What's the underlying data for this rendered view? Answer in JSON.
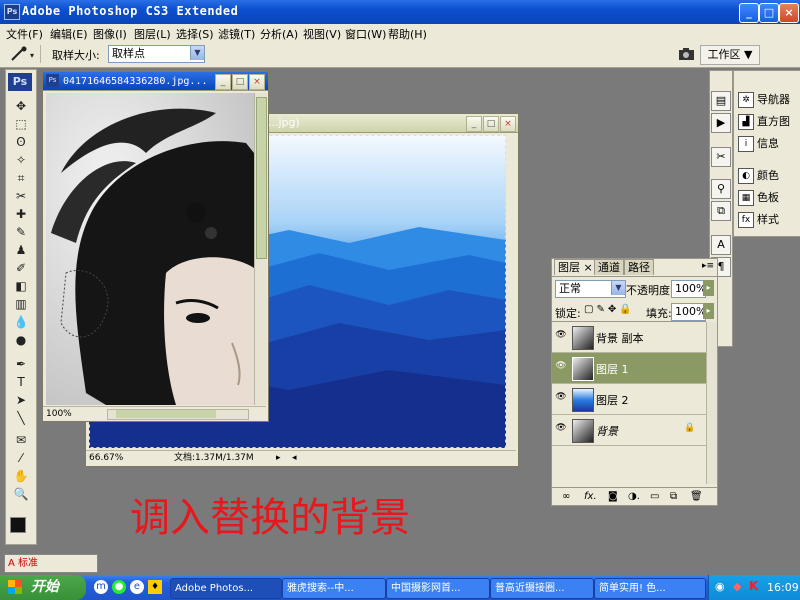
{
  "window": {
    "title": "Adobe Photoshop CS3 Extended",
    "app_badge": "Ps",
    "controls": {
      "minimize": "_",
      "maximize": "□",
      "close": "×"
    }
  },
  "menu": {
    "items": [
      "文件(F)",
      "编辑(E)",
      "图像(I)",
      "图层(L)",
      "选择(S)",
      "滤镜(T)",
      "分析(A)",
      "视图(V)",
      "窗口(W)",
      "帮助(H)"
    ]
  },
  "options_bar": {
    "sample_size_label": "取样大小:",
    "sample_size_value": "取样点",
    "workspace_label": "工作区 ▼"
  },
  "toolbox": {
    "badge": "Ps",
    "tools": [
      "move-tool",
      "marquee-tool",
      "lasso-tool",
      "magic-wand-tool",
      "crop-tool",
      "slice-tool",
      "healing-tool",
      "brush-tool",
      "stamp-tool",
      "history-brush-tool",
      "eraser-tool",
      "gradient-tool",
      "blur-tool",
      "dodge-tool",
      "pen-tool",
      "type-tool",
      "path-select-tool",
      "line-tool",
      "notes-tool",
      "eyedropper-tool",
      "hand-tool",
      "zoom-tool"
    ],
    "tool_glyphs": [
      "✥",
      "⬚",
      "ʘ",
      "✧",
      "⌗",
      "✂",
      "✚",
      "✎",
      "♟",
      "✐",
      "◧",
      "▥",
      "💧",
      "●",
      "✒",
      "T",
      "➤",
      "╲",
      "✉",
      "⁄",
      "✋",
      "🔍"
    ],
    "foreground_color": "#111111",
    "background_color": "#ffffff"
  },
  "doc_front": {
    "title": "04171646584336280.jpg...",
    "zoom": "100%"
  },
  "doc_back": {
    "title": "...jpg)",
    "zoom": "66.67%",
    "doc_info": "文档:1.37M/1.37M"
  },
  "layers_panel": {
    "tabs": [
      "图层 ×",
      "通道",
      "路径"
    ],
    "blend_mode": "正常",
    "opacity_label": "不透明度:",
    "opacity_value": "100%",
    "lock_label": "锁定:",
    "fill_label": "填充:",
    "fill_value": "100%",
    "layers": [
      {
        "name": "背景 副本",
        "selected": false,
        "thumb": "portrait"
      },
      {
        "name": "图层 1",
        "selected": true,
        "thumb": "portrait"
      },
      {
        "name": "图层 2",
        "selected": false,
        "thumb": "blue"
      },
      {
        "name": "背景",
        "selected": false,
        "thumb": "portrait",
        "locked": true
      }
    ],
    "footer_icons": [
      "link-icon",
      "fx-icon",
      "mask-icon",
      "adjustment-icon",
      "folder-icon",
      "new-layer-icon",
      "trash-icon"
    ]
  },
  "right_panels": {
    "navigator": "导航器",
    "histogram": "直方图",
    "info": "信息",
    "color": "颜色",
    "swatches": "色板",
    "styles": "样式"
  },
  "caption": "调入替换的背景",
  "taskbar": {
    "start": "开始",
    "tasks": [
      "Adobe Photos...",
      "雅虎搜索--中...",
      "中国摄影网首...",
      "普高近摄接圈...",
      "简单实用! 色..."
    ],
    "clock": "16:09",
    "ime": "A 标准"
  },
  "colors": {
    "titlebar": "#0c4fd0",
    "panel_bg": "#ece9d8",
    "layer_selected": "#8b9a64",
    "caption": "#e8171d"
  }
}
